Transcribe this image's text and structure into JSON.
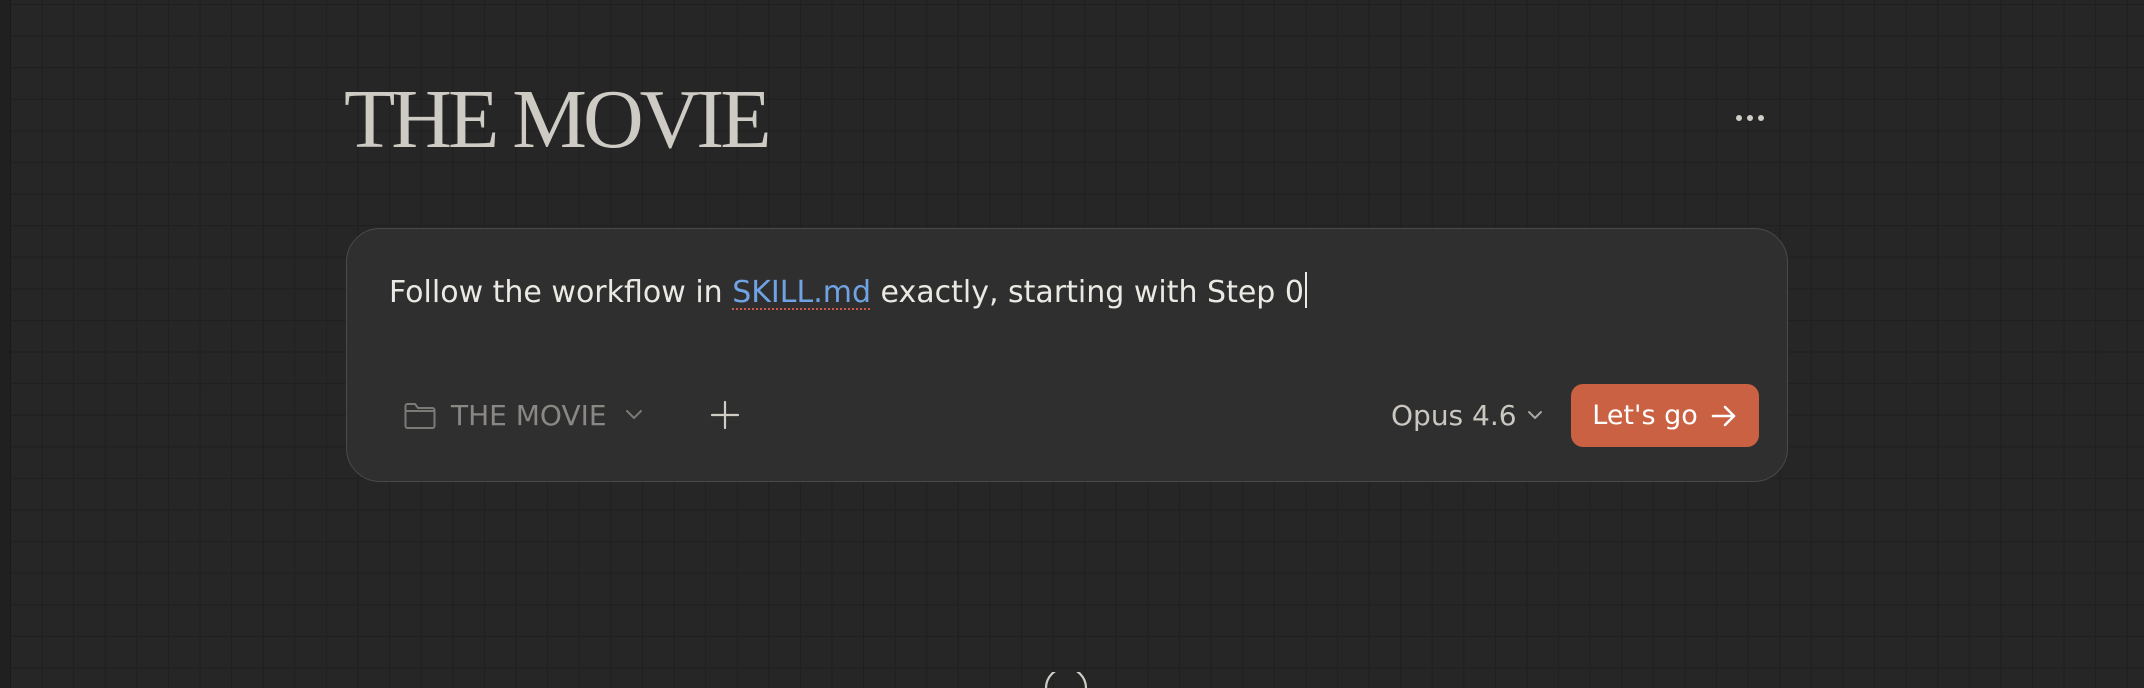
{
  "header": {
    "project_title": "THE MOVIE",
    "more_icon": "more-horizontal-icon"
  },
  "composer": {
    "prompt_before": "Follow the workflow in ",
    "file_reference": "SKILL.md",
    "prompt_after": " exactly, starting with Step 0",
    "folder": {
      "icon": "folder-icon",
      "label": "THE MOVIE"
    },
    "add_icon": "plus-icon",
    "model": {
      "label": "Opus 4.6",
      "icon": "chevron-down-icon"
    },
    "submit": {
      "label": "Let's go",
      "icon": "arrow-right-icon"
    }
  },
  "colors": {
    "background": "#262626",
    "grid_line": "#1f1f1f",
    "composer_bg": "#2f2f2f",
    "accent": "#c96142",
    "link": "#6fa3e3",
    "spellcheck_underline": "#cf5a4a"
  }
}
